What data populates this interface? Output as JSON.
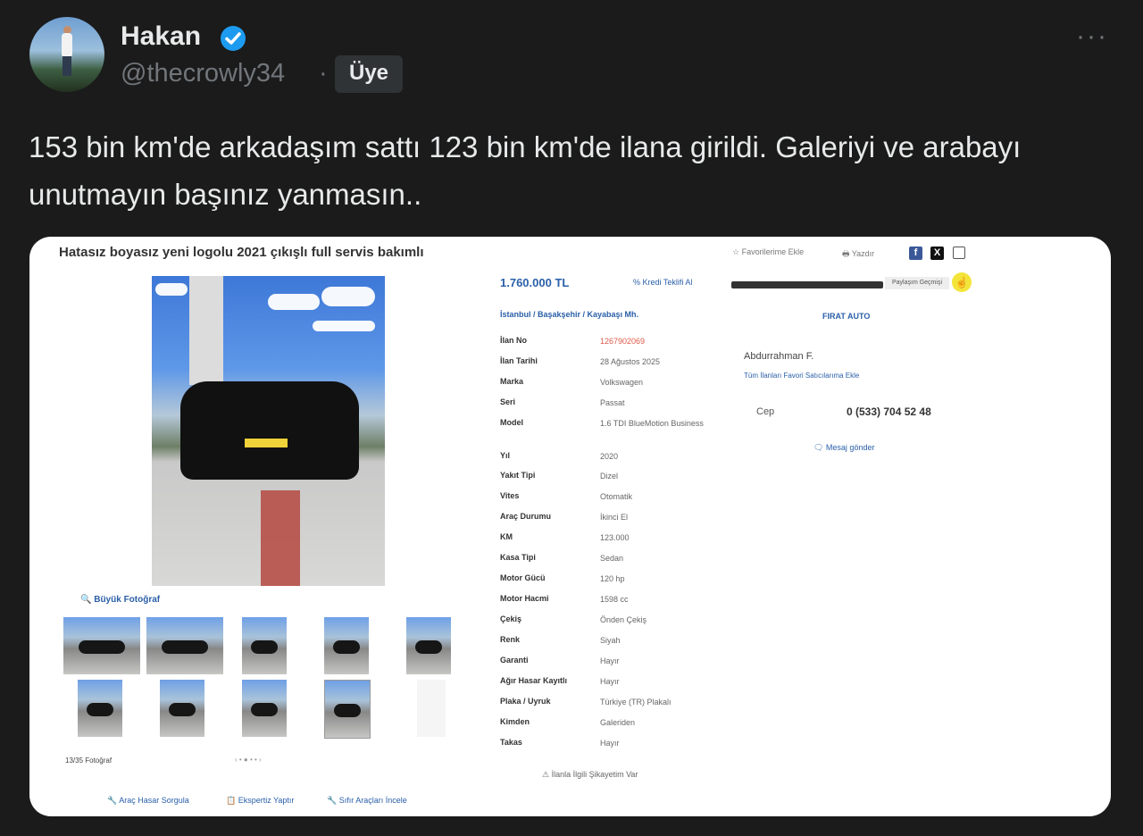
{
  "tweet": {
    "name": "Hakan",
    "handle": "@thecrowly34",
    "separator": "·",
    "badge": "Üye",
    "more": "···",
    "text": "153 bin km'de arkadaşım sattı 123 bin km'de ilana girildi. Galeriyi ve arabayı unutmayın başınız yanmasın.."
  },
  "listing": {
    "title": "Hatasız boyasız yeni logolu 2021 çıkışlı full servis bakımlı",
    "favorites": "☆ Favorilerime Ekle",
    "print": "🖶 Yazdır",
    "price": "1.760.000 TL",
    "loan": "% Kredi Teklifi Al",
    "breadcrumb": "İstanbul  /  Başakşehir  /  Kayabaşı Mh.",
    "big_photo": "🔍 Büyük Fotoğraf",
    "photo_count": "13/35 Fotoğraf",
    "pager": "‹   •  ●  •  •   ›",
    "complaint": "⚠ İlanla İlgili Şikayetim Var",
    "specs": [
      {
        "key": "İlan No",
        "value": "1267902069"
      },
      {
        "key": "İlan Tarihi",
        "value": "28 Ağustos 2025"
      },
      {
        "key": "Marka",
        "value": "Volkswagen"
      },
      {
        "key": "Seri",
        "value": "Passat"
      },
      {
        "key": "Model",
        "value": "1.6 TDI BlueMotion Business"
      },
      {
        "key": "Yıl",
        "value": "2020"
      },
      {
        "key": "Yakıt Tipi",
        "value": "Dizel"
      },
      {
        "key": "Vites",
        "value": "Otomatik"
      },
      {
        "key": "Araç Durumu",
        "value": "İkinci El"
      },
      {
        "key": "KM",
        "value": "123.000"
      },
      {
        "key": "Kasa Tipi",
        "value": "Sedan"
      },
      {
        "key": "Motor Gücü",
        "value": "120 hp"
      },
      {
        "key": "Motor Hacmi",
        "value": "1598 cc"
      },
      {
        "key": "Çekiş",
        "value": "Önden Çekiş"
      },
      {
        "key": "Renk",
        "value": "Siyah"
      },
      {
        "key": "Garanti",
        "value": "Hayır"
      },
      {
        "key": "Ağır Hasar Kayıtlı",
        "value": "Hayır"
      },
      {
        "key": "Plaka / Uyruk",
        "value": "Türkiye (TR) Plakalı"
      },
      {
        "key": "Kimden",
        "value": "Galeriden"
      },
      {
        "key": "Takas",
        "value": "Hayır"
      }
    ],
    "seller": {
      "bar_button": "Paylaşım Geçmişi",
      "shop": "FIRAT AUTO",
      "name": "Abdurrahman F.",
      "links": "Tüm İlanları    Favori Satıcılarıma Ekle",
      "cep_label": "Cep",
      "phone": "0 (533) 704 52 48",
      "message": "🗨 Mesaj gönder"
    },
    "bottom_links": [
      "🔧 Araç Hasar Sorgula",
      "📋 Ekspertiz Yaptır",
      "🔧 Sıfır Araçları İncele"
    ]
  }
}
